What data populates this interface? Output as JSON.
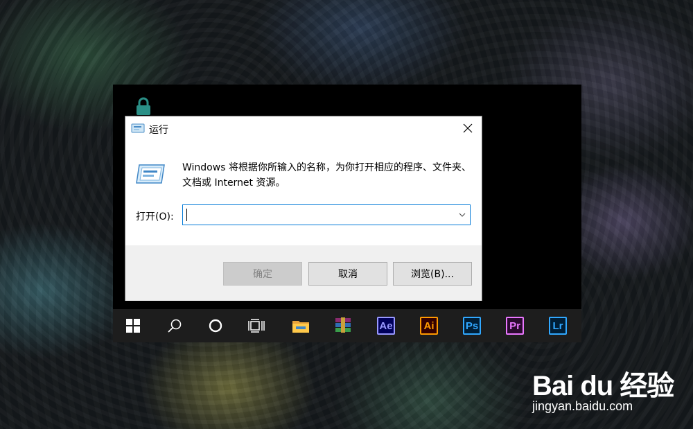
{
  "dialog": {
    "title": "运行",
    "description": "Windows 将根据你所输入的名称，为你打开相应的程序、文件夹、文档或 Internet 资源。",
    "open_label": "打开(O):",
    "open_value": "",
    "ok_label": "确定",
    "cancel_label": "取消",
    "browse_label": "浏览(B)..."
  },
  "taskbar": {
    "items": [
      {
        "icon": "windows-start-icon"
      },
      {
        "icon": "search-icon"
      },
      {
        "icon": "cortana-icon"
      },
      {
        "icon": "task-view-icon"
      },
      {
        "icon": "file-explorer-icon"
      },
      {
        "icon": "winrar-icon"
      },
      {
        "icon": "after-effects-icon",
        "text": "Ae",
        "color": "#9999ff",
        "bg": "#00005b"
      },
      {
        "icon": "illustrator-icon",
        "text": "Ai",
        "color": "#ff9a00",
        "bg": "#330000"
      },
      {
        "icon": "photoshop-icon",
        "text": "Ps",
        "color": "#31a8ff",
        "bg": "#001e36"
      },
      {
        "icon": "premiere-icon",
        "text": "Pr",
        "color": "#ea77ff",
        "bg": "#2a0a2f"
      },
      {
        "icon": "lightroom-icon",
        "text": "Lr",
        "color": "#31a8ff",
        "bg": "#001e36"
      }
    ]
  },
  "watermark": {
    "main": "Bai du 经验",
    "sub": "jingyan.baidu.com"
  },
  "colors": {
    "accent": "#0078d7",
    "taskbar": "#1d1d1d",
    "dialog_footer": "#f0f0f0"
  }
}
